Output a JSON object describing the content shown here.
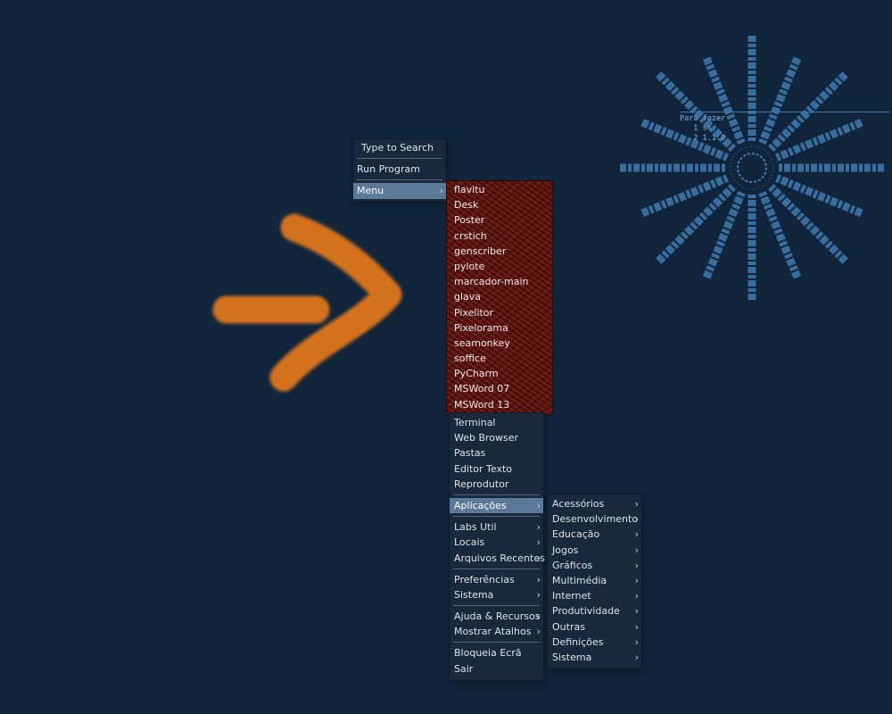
{
  "root_menu": {
    "search_placeholder": "Type to Search",
    "run_program": "Run Program",
    "menu_label": "Menu"
  },
  "favorites": [
    "flavitu",
    "Desk",
    "Poster",
    "crstich",
    "genscriber",
    "pylote",
    "marcador-main",
    "glava",
    "Pixelitor",
    "Pixelorama",
    "seamonkey",
    "soffice",
    "PyCharm",
    "MSWord 07",
    "MSWord 13"
  ],
  "main_menu": {
    "launchers": [
      "Terminal",
      "Web Browser",
      "Pastas",
      "Editor Texto",
      "Reprodutor"
    ],
    "applications": "Aplicações",
    "group2": [
      "Labs Util",
      "Locais",
      "Arquivos Recentes"
    ],
    "group3": [
      "Preferências",
      "Sistema"
    ],
    "group4": [
      "Ajuda & Recursos",
      "Mostrar Atalhos"
    ],
    "lock_screen": "Bloqueia Ecrã",
    "quit": "Sair"
  },
  "applications_menu": [
    "Acessórios",
    "Desenvolvimento",
    "Educação",
    "Jogos",
    "Gráficos",
    "Multimédia",
    "Internet",
    "Produtividade",
    "Outras",
    "Definições",
    "Sistema"
  ],
  "wallpaper_note": {
    "line1": "Para fazer",
    "line2": "1 ss.",
    "line3": "2 1.1.0"
  },
  "colors": {
    "desktop": "#10253b",
    "menu_bg": "#19283a",
    "menu_highlight": "#5b7a9a",
    "favorites_bg": "#5c1410",
    "arrow": "#d4711f",
    "wallpaper_art": "#3f7bb0"
  },
  "icons": {
    "search": "search-icon",
    "submenu": "chevron-right-icon",
    "wallpaper": "starburst-icon",
    "annotation": "arrow-right-icon"
  }
}
